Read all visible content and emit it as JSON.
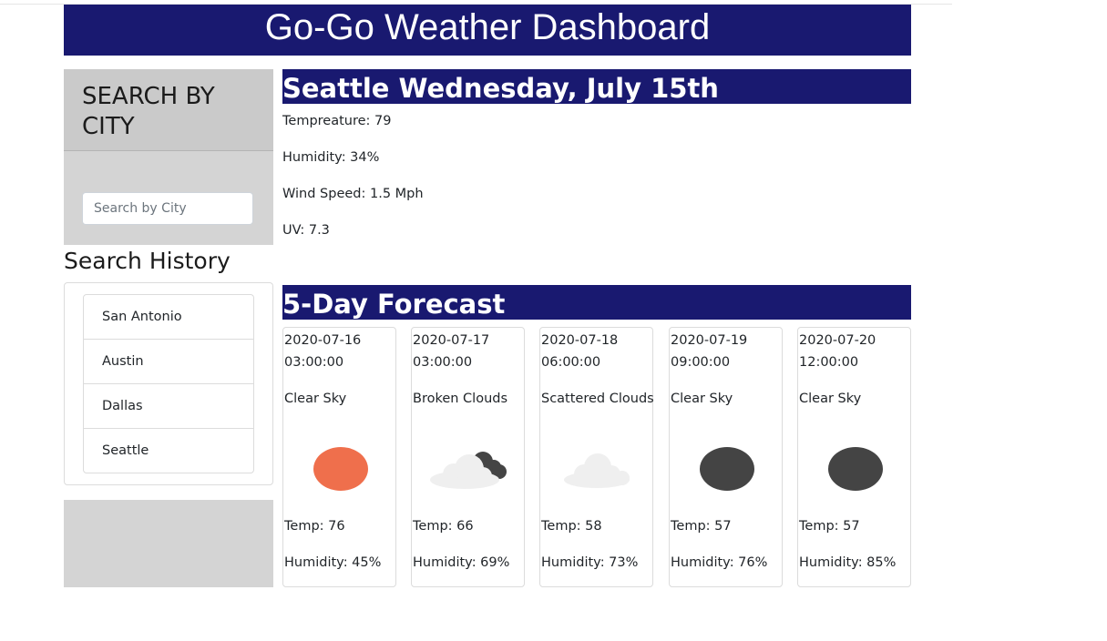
{
  "header": {
    "title": "Go-Go Weather Dashboard"
  },
  "search": {
    "title": "SEARCH BY CITY",
    "placeholder": "Search by City"
  },
  "history": {
    "title": "Search History",
    "items": [
      {
        "label": "San Antonio"
      },
      {
        "label": "Austin"
      },
      {
        "label": "Dallas"
      },
      {
        "label": "Seattle"
      }
    ]
  },
  "current": {
    "heading": "Seattle Wednesday, July 15th",
    "temperature": "Tempreature: 79",
    "humidity": "Humidity: 34%",
    "wind": "Wind Speed: 1.5 Mph",
    "uv": "UV: 7.3"
  },
  "forecast": {
    "heading": "5-Day Forecast",
    "days": [
      {
        "date": "2020-07-16",
        "time": "03:00:00",
        "desc": "Clear Sky",
        "icon": "sun-icon",
        "temp": "Temp: 76",
        "humidity": "Humidity: 45%"
      },
      {
        "date": "2020-07-17",
        "time": "03:00:00",
        "desc": "Broken Clouds",
        "icon": "broken-clouds-icon",
        "temp": "Temp: 66",
        "humidity": "Humidity: 69%"
      },
      {
        "date": "2020-07-18",
        "time": "06:00:00",
        "desc": "Scattered Clouds",
        "icon": "cloud-icon",
        "temp": "Temp: 58",
        "humidity": "Humidity: 73%"
      },
      {
        "date": "2020-07-19",
        "time": "09:00:00",
        "desc": "Clear Sky",
        "icon": "moon-icon",
        "temp": "Temp: 57",
        "humidity": "Humidity: 76%"
      },
      {
        "date": "2020-07-20",
        "time": "12:00:00",
        "desc": "Clear Sky",
        "icon": "moon-icon",
        "temp": "Temp: 57",
        "humidity": "Humidity: 85%"
      }
    ]
  },
  "colors": {
    "navy": "#191970",
    "panel_gray": "#d4d4d4",
    "sun": "#ef6f4c",
    "night": "#444444",
    "cloud_light": "#efefef"
  }
}
